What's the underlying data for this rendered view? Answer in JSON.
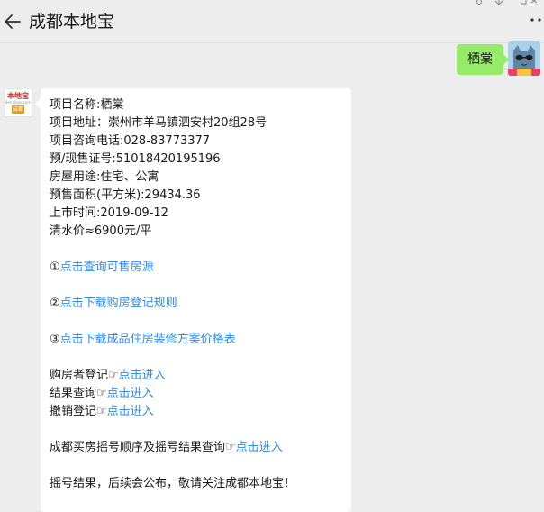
{
  "header": {
    "title": "成都本地宝",
    "back_icon": "arrow-left-icon",
    "more_icon": "more-dots-icon"
  },
  "user_message": {
    "text": "栖棠"
  },
  "bot_avatar": {
    "logo_text": "本地宝",
    "logo_sub": "Bendibao.com",
    "badge": "成都"
  },
  "bot_message": {
    "info_lines": [
      "项目名称:栖棠",
      "项目地址：崇州市羊马镇泗安村20组28号",
      "项目咨询电话:028-83773377",
      "预/现售证号:51018420195196",
      "房屋用途:住宅、公寓",
      "预售面积(平方米):29434.36",
      "上市时间:2019-09-12",
      "清水价≈6900元/平"
    ],
    "link1_prefix": "①",
    "link1_text": "点击查询可售房源",
    "link2_prefix": "②",
    "link2_text": "点击下载购房登记规则",
    "link3_prefix": "③",
    "link3_text": "点击下载成品住房装修方案价格表",
    "register_label": "购房者登记",
    "register_link": "点击进入",
    "result_label": "结果查询",
    "result_link": "点击进入",
    "cancel_label": "撤销登记",
    "cancel_link": "点击进入",
    "lottery_label": "成都买房摇号顺序及摇号结果查询",
    "lottery_link": "点击进入",
    "pointer_glyph": "☞",
    "footer_text": "摇号结果，后续会公布，敬请关注成都本地宝！"
  },
  "colors": {
    "background": "#ededed",
    "user_bubble": "#95ec69",
    "link": "#2d8cf0",
    "logo_red": "#e2231a",
    "badge_orange": "#f39800"
  }
}
